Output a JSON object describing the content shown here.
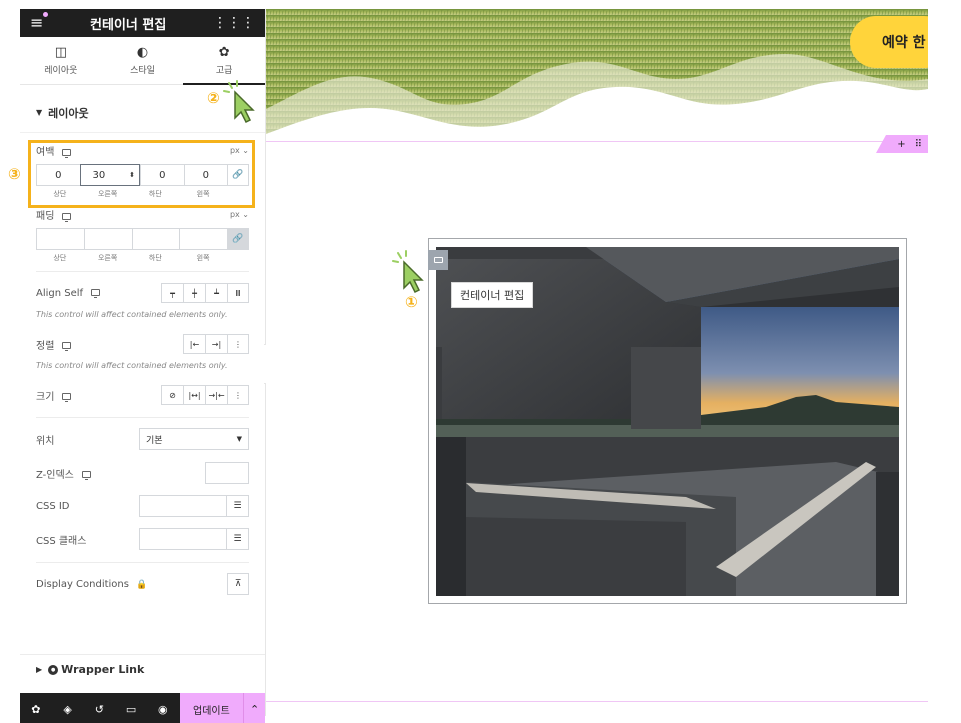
{
  "sidebar": {
    "title": "컨테이너 편집",
    "tabs": [
      {
        "label": "레이아웃",
        "icon": "layout-icon"
      },
      {
        "label": "스타일",
        "icon": "contrast-icon"
      },
      {
        "label": "고급",
        "icon": "gear-icon"
      }
    ],
    "active_tab": "고급",
    "section_layout": "레이아웃",
    "margin": {
      "label": "여백",
      "unit": "px",
      "values": [
        "0",
        "30",
        "0",
        "0"
      ],
      "sides": [
        "상단",
        "오른쪽",
        "하단",
        "왼쪽"
      ]
    },
    "padding": {
      "label": "패딩",
      "unit": "px",
      "values": [
        "",
        "",
        "",
        ""
      ],
      "sides": [
        "상단",
        "오른쪽",
        "하단",
        "왼쪽"
      ]
    },
    "align_self": {
      "label": "Align Self",
      "note": "This control will affect contained elements only."
    },
    "order": {
      "label": "정렬",
      "note": "This control will affect contained elements only."
    },
    "size": {
      "label": "크기"
    },
    "position": {
      "label": "위치",
      "value": "기본"
    },
    "z_index": {
      "label": "Z-인덱스",
      "value": ""
    },
    "css_id": {
      "label": "CSS ID",
      "value": ""
    },
    "css_classes": {
      "label": "CSS 클래스",
      "value": ""
    },
    "display_conditions": {
      "label": "Display Conditions"
    },
    "wrapper_link": {
      "label": "Wrapper Link"
    },
    "update_label": "업데이트"
  },
  "canvas": {
    "reserve_button": "예약 한",
    "tooltip": "컨테이너 편집"
  },
  "annotations": [
    "①",
    "②",
    "③"
  ],
  "colors": {
    "accent_pink": "#f0abfc",
    "highlight_yellow": "#f5b21b",
    "reserve_yellow": "#ffd43b",
    "dark": "#1f1f1f"
  }
}
